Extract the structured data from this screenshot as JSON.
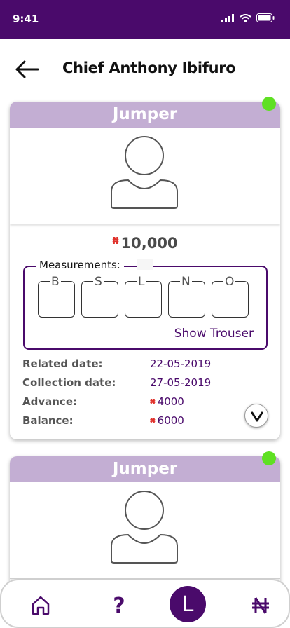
{
  "status_bar": {
    "time": "9:41",
    "icons": [
      "signal-icon",
      "wifi-icon",
      "battery-icon"
    ]
  },
  "header": {
    "title": "Chief Anthony Ibifuro",
    "back_icon": "back-arrow-icon"
  },
  "orders": [
    {
      "garment": "Jumper",
      "online": true,
      "price": "10,000",
      "measurements_label": "Measurements:",
      "measurements": [
        "B",
        "S",
        "L",
        "N",
        "O"
      ],
      "toggle_label": "Show Trouser",
      "details": [
        {
          "label": "Related date:",
          "value": "22-05-2019"
        },
        {
          "label": "Collection date:",
          "value": "27-05-2019"
        },
        {
          "label": "Advance:",
          "value": "4000",
          "currency": true
        },
        {
          "label": "Balance:",
          "value": "6000",
          "currency": true
        }
      ]
    },
    {
      "garment": "Jumper",
      "online": true
    }
  ],
  "currency_symbol": "₦",
  "bottom_nav": {
    "items": [
      "home-icon",
      "help-icon",
      "profile-L",
      "naira-icon"
    ],
    "help_label": "?",
    "profile_label": "L"
  },
  "colors": {
    "primary": "#4a0a6b",
    "card_header": "#c3aed3",
    "online": "#5fe023",
    "naira": "#e0312b"
  }
}
